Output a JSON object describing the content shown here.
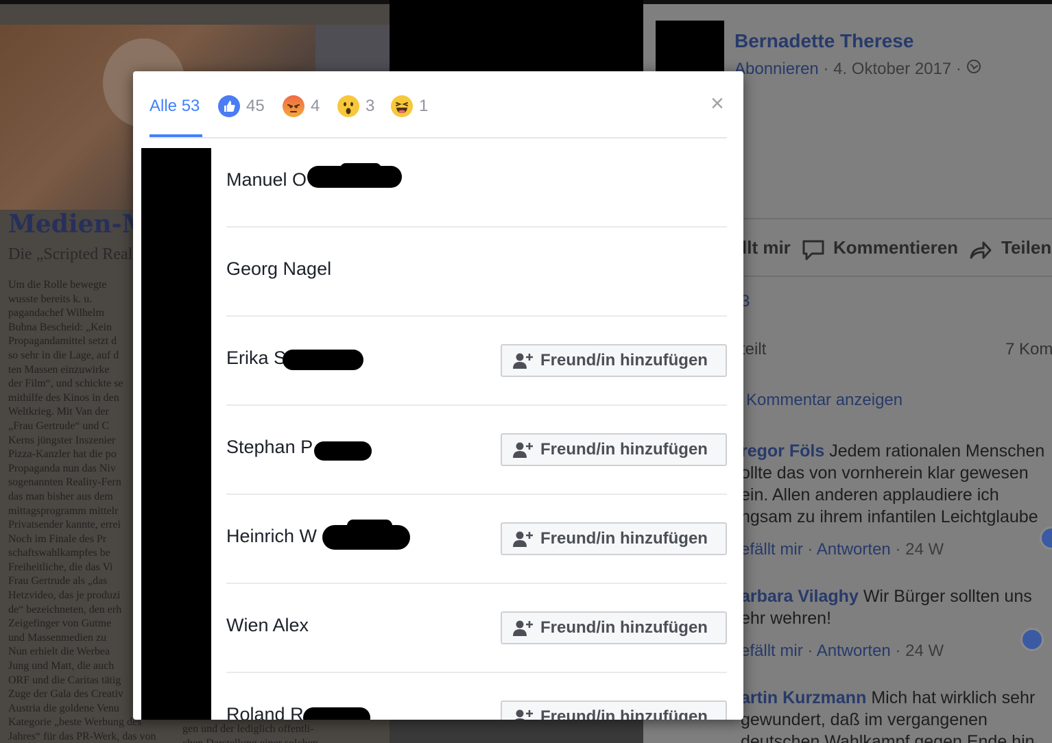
{
  "background": {
    "newspaper": {
      "headline": "Medien-M",
      "subtitle": "Die „Scripted Real",
      "body_lines": [
        "Um die Rolle bewegte",
        "wusste bereits k. u.",
        "pagandachef Wilhelm",
        "Bubna Bescheid: „Kein",
        "Propagandamittel setzt d",
        "so sehr in die Lage, auf d",
        "ten Massen einzuwirke",
        "der Film“, und schickte se",
        "mithilfe des Kinos in den",
        "Weltkrieg. Mit Van der",
        "„Frau Gertrude“ und C",
        "Kerns jüngster Inszenier",
        "Pizza-Kanzler hat die po",
        "Propaganda nun das Niv",
        "sogenannten Reality-Fern",
        "das man bisher aus dem",
        "mittagsprogramm mittelr",
        "Privatsender kannte, errei",
        "Noch im Finale des Pr",
        "schaftswahlkampfes be",
        "Freiheitliche, die das Vi",
        "Frau Gertrude als „das",
        "Hetzvideo, das je produzi",
        "de“ bezeichneten, den erh",
        "Zeigefinger von Gutme",
        "und Massenmedien zu",
        "Nun erhielt die Werbea",
        "Jung und Matt, die auch",
        "ORF und die Caritas tätig",
        "Zuge der Gala des Creativ",
        "Austria die goldene Venu",
        "Kategorie „beste Werbung des",
        "Jahres“ für das PR-Werk, das von"
      ],
      "body2_lines": [
        "gen und der lediglich offentli-",
        "chen Darstellung einer solchen"
      ]
    },
    "post": {
      "author": "Bernadette Therese",
      "follow": "Abonnieren",
      "date": "4. Oktober 2017",
      "sep": "·",
      "action_like": "llt mir",
      "action_comment": "Kommentieren",
      "action_share": "Teilen",
      "reaction_count": "3",
      "shares": "teilt",
      "comments_count": "7 Kom",
      "show_comment": "Kommentar anzeigen",
      "comments": [
        {
          "author": "regor Föls",
          "text": "Jedem rationalen Menschen",
          "lines": [
            "ollte das von vornherein klar gewesen",
            "ein. Allen anderen applaudiere ich",
            "ngsam zu ihrem infantilen Leichtglaube"
          ],
          "like": "efällt mir",
          "reply": "Antworten",
          "age": "24 W"
        },
        {
          "author": "arbara Vilaghy",
          "text": "Wir Bürger sollten uns",
          "lines": [
            "ehr wehren!"
          ],
          "like": "efällt mir",
          "reply": "Antworten",
          "age": "24 W"
        },
        {
          "author": "artin Kurzmann",
          "text": "Mich hat wirklich sehr",
          "lines": [
            "gewundert, daß im vergangenen",
            "deutschen Wahlkampf gegen Ende hin"
          ]
        }
      ]
    }
  },
  "modal": {
    "tabs": [
      {
        "label": "Alle 53",
        "icon": "",
        "active": true
      },
      {
        "label": "45",
        "icon": "like-icon"
      },
      {
        "label": "4",
        "icon": "angry-icon"
      },
      {
        "label": "3",
        "icon": "wow-icon"
      },
      {
        "label": "1",
        "icon": "haha-icon"
      }
    ],
    "close_label": "×",
    "add_friend_label": "Freund/in hinzufügen",
    "people": [
      {
        "name": "Manuel O",
        "has_button": false
      },
      {
        "name": "Georg Nagel",
        "has_button": false
      },
      {
        "name": "Erika S",
        "has_button": true
      },
      {
        "name": "Stephan P",
        "has_button": true
      },
      {
        "name": "Heinrich W",
        "has_button": true
      },
      {
        "name": "Wien Alex",
        "has_button": true
      },
      {
        "name": "Roland R",
        "has_button": true
      }
    ]
  },
  "colors": {
    "accent": "#4080ff",
    "like": "#4a7cf3",
    "name_text": "#1d2129",
    "button_text": "#4b4f56"
  }
}
